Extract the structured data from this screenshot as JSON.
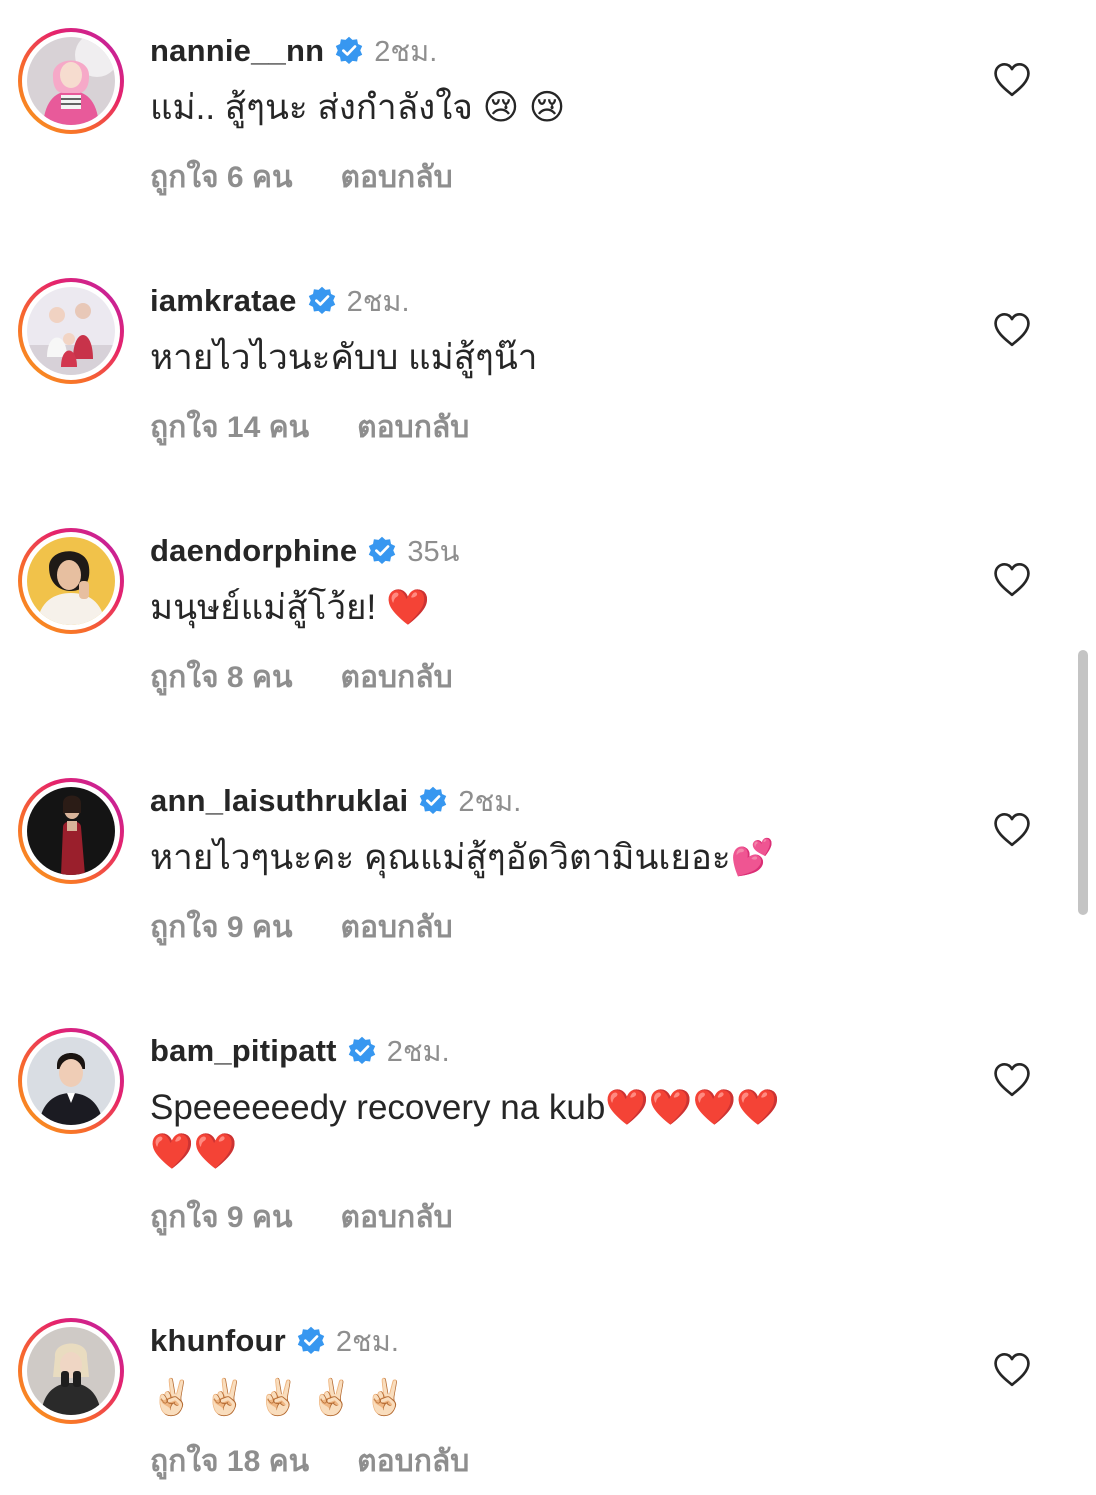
{
  "comments": [
    {
      "username": "nannie__nn",
      "time": "2ชม.",
      "text": "แม่.. สู้ๆนะ ส่งกำลังใจ 😢 😢",
      "likes": "ถูกใจ 6 คน",
      "reply": "ตอบกลับ",
      "verified": true,
      "avatar_colors": [
        "#f4b6d0",
        "#e85a9a"
      ]
    },
    {
      "username": "iamkratae",
      "time": "2ชม.",
      "text": "หายไวไวนะคับบ แม่สู้ๆน๊า",
      "likes": "ถูกใจ 14 คน",
      "reply": "ตอบกลับ",
      "verified": true,
      "avatar_colors": [
        "#e9e6ee",
        "#c8334a"
      ]
    },
    {
      "username": "daendorphine",
      "time": "35น",
      "text": "มนุษย์แม่สู้โว้ย! ❤️",
      "likes": "ถูกใจ 8 คน",
      "reply": "ตอบกลับ",
      "verified": true,
      "avatar_colors": [
        "#f1c24a",
        "#f6f1ea"
      ]
    },
    {
      "username": "ann_laisuthruklai",
      "time": "2ชม.",
      "text": "หายไวๆนะคะ คุณแม่สู้ๆอัดวิตามินเยอะ💕",
      "likes": "ถูกใจ 9 คน",
      "reply": "ตอบกลับ",
      "verified": true,
      "avatar_colors": [
        "#141414",
        "#9a1f2c"
      ]
    },
    {
      "username": "bam_pitipatt",
      "time": "2ชม.",
      "text": "Speeeeeedy recovery na kub❤️❤️❤️❤️\n❤️❤️",
      "likes": "ถูกใจ 9 คน",
      "reply": "ตอบกลับ",
      "verified": true,
      "avatar_colors": [
        "#d9dde3",
        "#1b1b22"
      ]
    },
    {
      "username": "khunfour",
      "time": "2ชม.",
      "text": "✌🏻 ✌🏻 ✌🏻 ✌🏻 ✌🏻",
      "likes": "ถูกใจ 18 คน",
      "reply": "ตอบกลับ",
      "verified": true,
      "avatar_colors": [
        "#cfcac6",
        "#2a2a2a"
      ]
    }
  ],
  "colors": {
    "primary_text": "#262626",
    "secondary_text": "#8e8e8e",
    "verified_badge": "#3797f0",
    "story_ring": [
      "#f9a21a",
      "#e6236b",
      "#b522b3"
    ]
  },
  "icons": {
    "verified": "verified-badge-icon",
    "like": "heart-outline-icon"
  }
}
